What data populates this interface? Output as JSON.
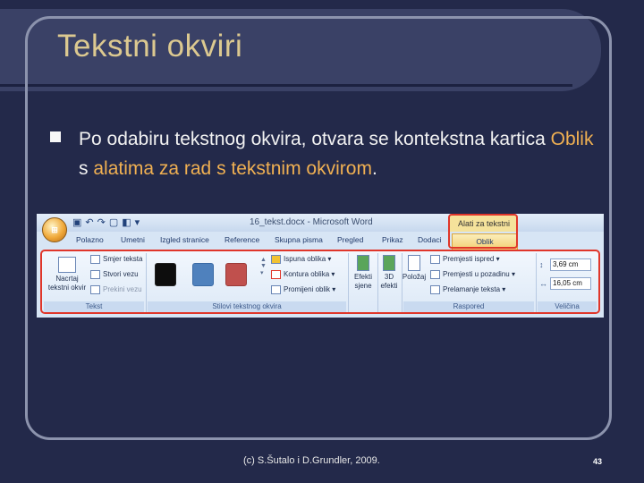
{
  "slide": {
    "title": "Tekstni okviri",
    "bullet": {
      "part1": "Po odabiru tekstnog okvira, otvara se kontekstna kartica ",
      "part2": "Oblik",
      "part3": " s ",
      "part4": "alatima za rad s tekstnim okvirom",
      "part5": "."
    },
    "footer": "(c) S.Šutalo i D.Grundler, 2009.",
    "page_number": "43"
  },
  "ribbon": {
    "doc_title": "16_tekst.docx - Microsoft Word",
    "context_label": "Alati za tekstni okvir",
    "tabs": [
      "Polazno",
      "Umetni",
      "Izgled stranice",
      "Reference",
      "Skupna pisma",
      "Pregled",
      "Prikaz",
      "Dodaci",
      "Oblik"
    ],
    "groups": {
      "tekst": {
        "label": "Tekst",
        "new_box": "Nacrtaj tekstni okvir",
        "direction": "Smjer teksta",
        "create_link": "Stvori vezu",
        "break_link": "Prekini vezu"
      },
      "styles": {
        "label": "Stilovi tekstnog okvira",
        "fill": "Ispuna oblika",
        "outline": "Kontura oblika",
        "change": "Promijeni oblik",
        "swatch_colors": [
          "#0d0d0d",
          "#4f81bd",
          "#c0504d"
        ]
      },
      "effects": {
        "shadow": "Efekti sjene",
        "three_d": "3D efekti"
      },
      "arrange": {
        "label": "Raspored",
        "position": "Položaj",
        "bring_front": "Premjesti ispred",
        "send_back": "Premjesti u pozadinu",
        "wrap": "Prelamanje teksta"
      },
      "size": {
        "label": "Veličina",
        "height": "3,69 cm",
        "width": "16,05 cm"
      }
    }
  }
}
